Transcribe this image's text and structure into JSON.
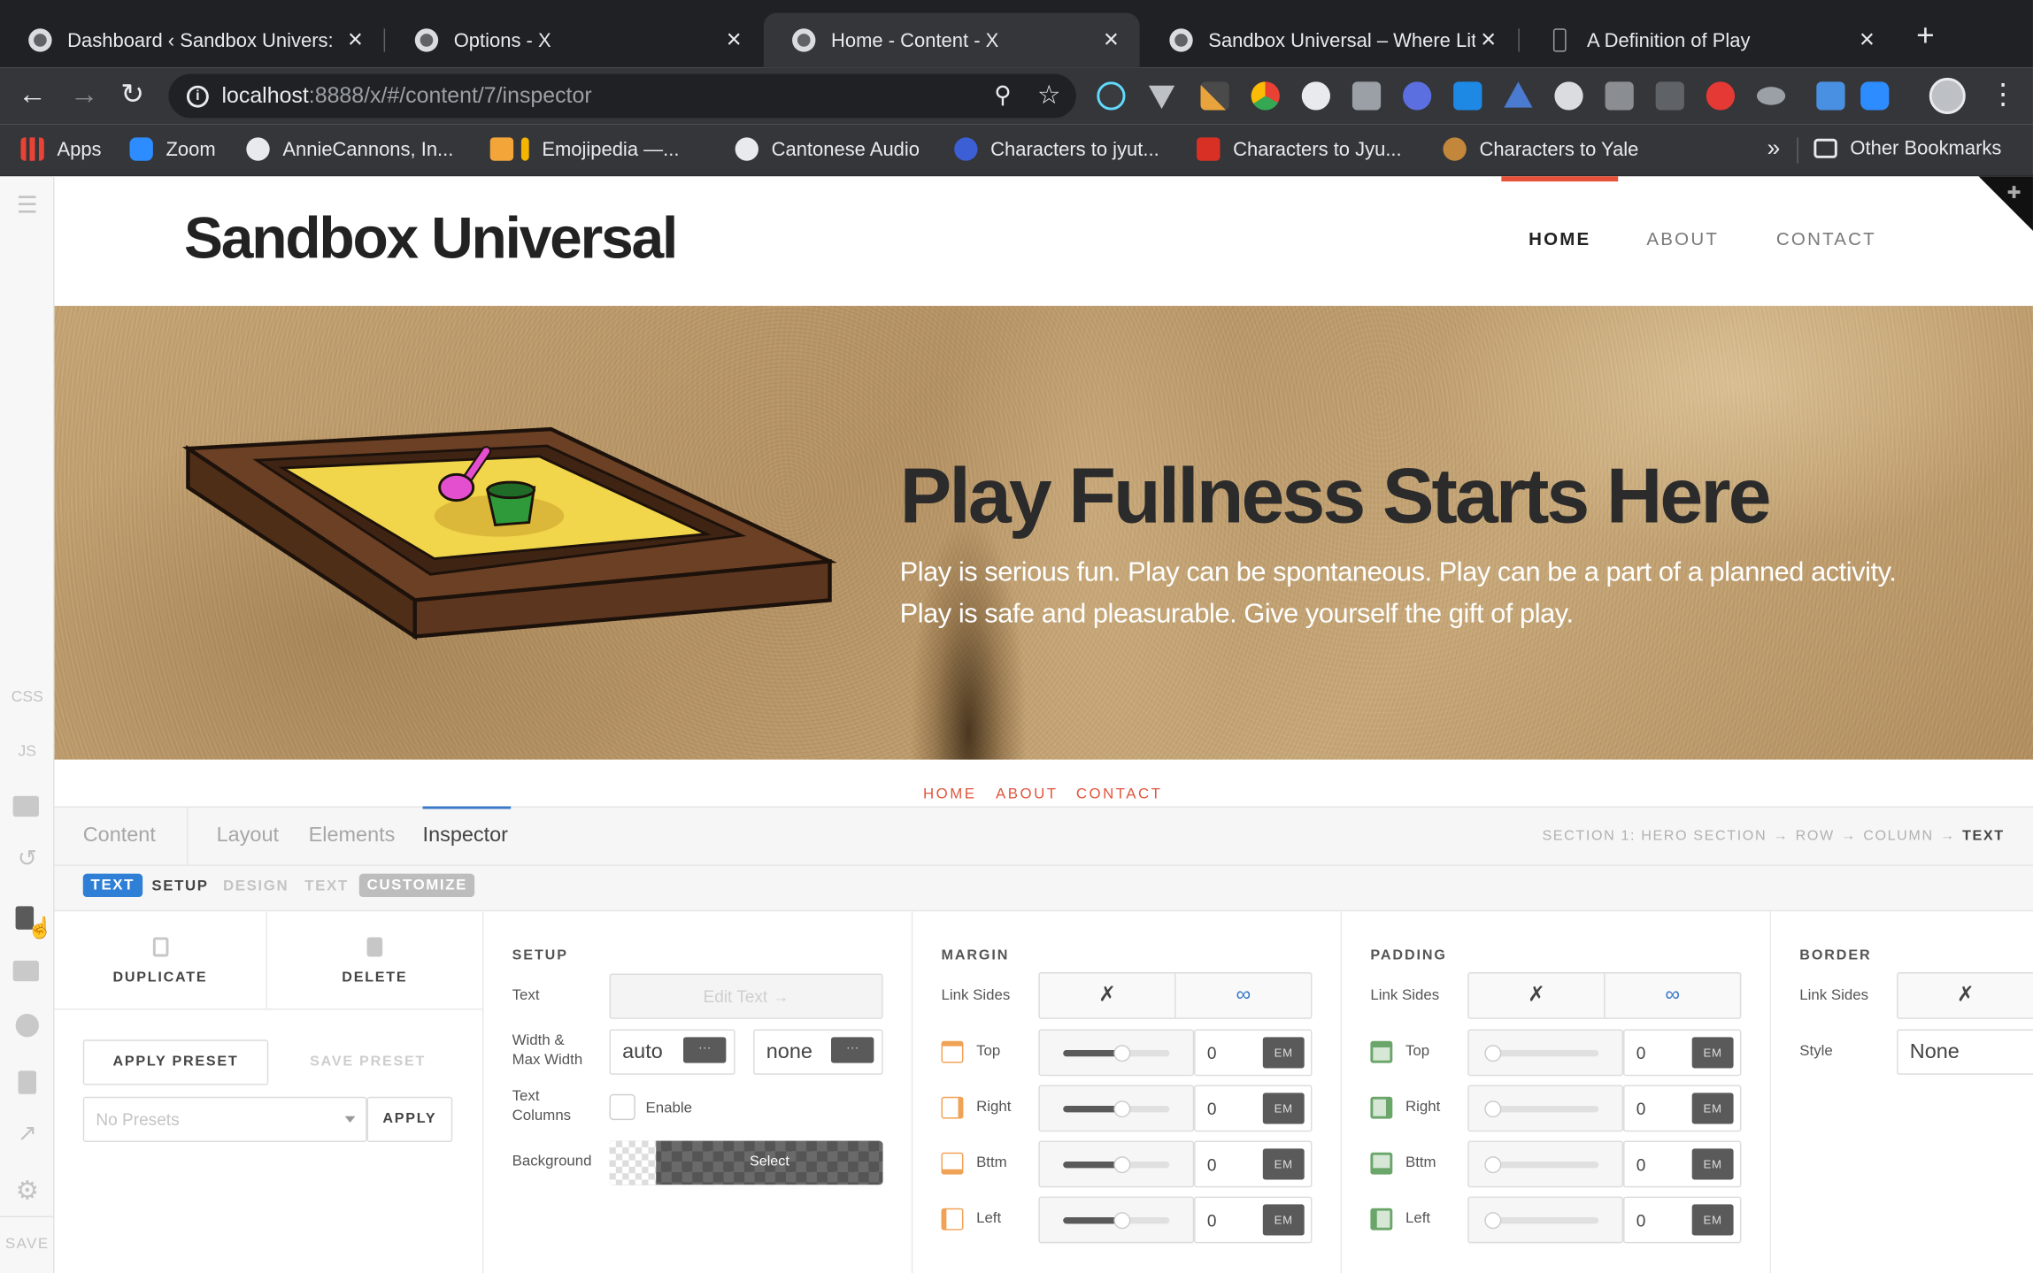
{
  "browser": {
    "tabs": [
      {
        "title": "Dashboard ‹ Sandbox Univers:"
      },
      {
        "title": "Options - X"
      },
      {
        "title": "Home - Content - X"
      },
      {
        "title": "Sandbox Universal – Where Lit"
      },
      {
        "title": "A Definition of Play"
      }
    ],
    "close_glyph": "×",
    "new_tab_glyph": "+",
    "url_host": "localhost",
    "url_path": ":8888/x/#/content/7/inspector",
    "bookmarks": [
      "Apps",
      "Zoom",
      "AnnieCannons, In...",
      "Emojipedia —...",
      "Cantonese Audio",
      "Characters to jyut...",
      "Characters to Jyu...",
      "Characters to Yale"
    ],
    "bookmarks_more": "»",
    "other_bookmarks": "Other Bookmarks"
  },
  "rail": {
    "css": "CSS",
    "js": "JS",
    "save": "SAVE"
  },
  "site": {
    "title": "Sandbox Universal",
    "nav": [
      "HOME",
      "ABOUT",
      "CONTACT"
    ],
    "hero_title": "Play Fullness Starts Here",
    "hero_text": "Play is serious fun. Play can be spontaneous. Play can be a part of a planned activity. Play is safe and pleasurable. Give yourself the gift of play.",
    "footer_nav": [
      "HOME",
      "ABOUT",
      "CONTACT"
    ]
  },
  "panel": {
    "tabs": [
      "Content",
      "Layout",
      "Elements",
      "Inspector"
    ],
    "active_tab": "Inspector",
    "breadcrumb": [
      "SECTION 1: HERO SECTION",
      "ROW",
      "COLUMN",
      "TEXT"
    ],
    "breadcrumb_arrow": "→",
    "subtabs": {
      "badge": "TEXT",
      "setup": "SETUP",
      "design": "DESIGN",
      "text": "TEXT",
      "customize": "CUSTOMIZE"
    },
    "actions": {
      "duplicate": "DUPLICATE",
      "delete": "DELETE",
      "apply_preset": "APPLY PRESET",
      "save_preset": "SAVE PRESET",
      "presets_placeholder": "No Presets",
      "apply": "APPLY"
    },
    "setup": {
      "title": "SETUP",
      "text_label": "Text",
      "edit_text": "Edit Text →",
      "width_label": "Width &\nMax Width",
      "width_value": "auto",
      "max_width_value": "none",
      "columns_label": "Text\nColumns",
      "enable_label": "Enable",
      "background_label": "Background",
      "select_label": "Select",
      "dots": "···"
    },
    "margin": {
      "title": "MARGIN",
      "link_sides": "Link Sides",
      "sides": [
        {
          "label": "Top",
          "value": "0",
          "unit": "EM",
          "slider": 0.55
        },
        {
          "label": "Right",
          "value": "0",
          "unit": "EM",
          "slider": 0.55
        },
        {
          "label": "Bttm",
          "value": "0",
          "unit": "EM",
          "slider": 0.55
        },
        {
          "label": "Left",
          "value": "0",
          "unit": "EM",
          "slider": 0.55
        }
      ]
    },
    "padding": {
      "title": "PADDING",
      "link_sides": "Link Sides",
      "sides": [
        {
          "label": "Top",
          "value": "0",
          "unit": "EM",
          "slider": 0
        },
        {
          "label": "Right",
          "value": "0",
          "unit": "EM",
          "slider": 0
        },
        {
          "label": "Bttm",
          "value": "0",
          "unit": "EM",
          "slider": 0
        },
        {
          "label": "Left",
          "value": "0",
          "unit": "EM",
          "slider": 0
        }
      ]
    },
    "border": {
      "title": "BORDER",
      "link_sides": "Link Sides",
      "style_label": "Style",
      "style_value": "None"
    }
  },
  "colors": {
    "accent_blue": "#3a79c9",
    "site_red": "#e0553e",
    "margin_orange": "#f0a257",
    "padding_green": "#6aa56a"
  }
}
